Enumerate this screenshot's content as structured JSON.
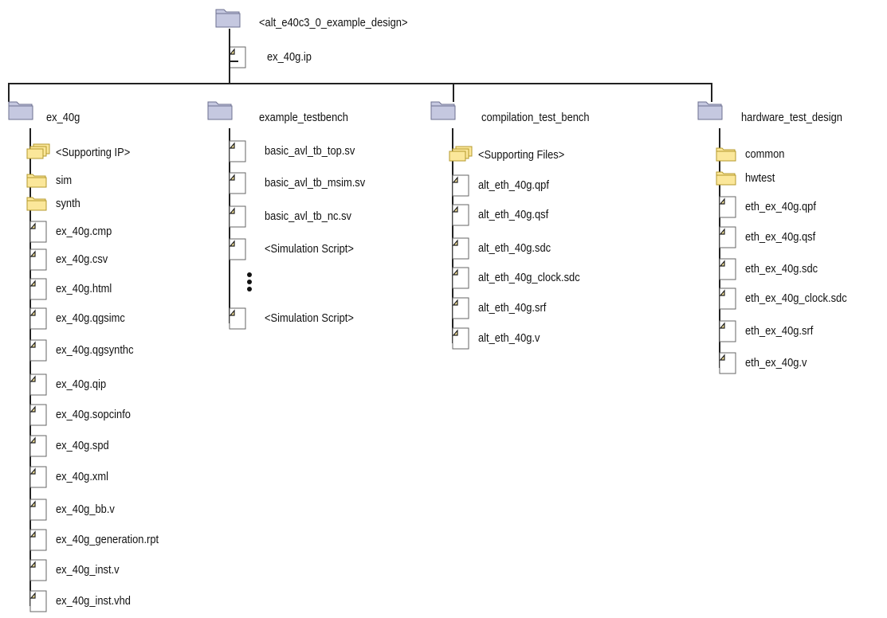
{
  "diagram": {
    "root": {
      "label": "<alt_e40c3_0_example_design>",
      "icon": "folder-icon",
      "children": [
        {
          "label": "ex_40g.ip",
          "icon": "file-icon"
        }
      ]
    },
    "columns": [
      {
        "label": "ex_40g",
        "icon": "folder-icon",
        "children": [
          {
            "label": "<Supporting IP>",
            "icon": "folder-stack-icon"
          },
          {
            "label": "sim",
            "icon": "folder-yellow-icon"
          },
          {
            "label": "synth",
            "icon": "folder-yellow-icon"
          },
          {
            "label": "ex_40g.cmp",
            "icon": "file-icon"
          },
          {
            "label": "ex_40g.csv",
            "icon": "file-icon"
          },
          {
            "label": "ex_40g.html",
            "icon": "file-icon"
          },
          {
            "label": "ex_40g.qgsimc",
            "icon": "file-icon"
          },
          {
            "label": "ex_40g.qgsynthc",
            "icon": "file-icon"
          },
          {
            "label": "ex_40g.qip",
            "icon": "file-icon"
          },
          {
            "label": "ex_40g.sopcinfo",
            "icon": "file-icon"
          },
          {
            "label": "ex_40g.spd",
            "icon": "file-icon"
          },
          {
            "label": "ex_40g.xml",
            "icon": "file-icon"
          },
          {
            "label": "ex_40g_bb.v",
            "icon": "file-icon"
          },
          {
            "label": "ex_40g_generation.rpt",
            "icon": "file-icon"
          },
          {
            "label": "ex_40g_inst.v",
            "icon": "file-icon"
          },
          {
            "label": "ex_40g_inst.vhd",
            "icon": "file-icon"
          }
        ]
      },
      {
        "label": "example_testbench",
        "icon": "folder-icon",
        "children": [
          {
            "label": "basic_avl_tb_top.sv",
            "icon": "file-icon"
          },
          {
            "label": "basic_avl_tb_msim.sv",
            "icon": "file-icon"
          },
          {
            "label": "basic_avl_tb_nc.sv",
            "icon": "file-icon"
          },
          {
            "label": "<Simulation Script>",
            "icon": "file-icon"
          },
          {
            "label": "",
            "icon": "ellipsis-icon"
          },
          {
            "label": "<Simulation Script>",
            "icon": "file-icon"
          }
        ]
      },
      {
        "label": "compilation_test_bench",
        "icon": "folder-icon",
        "children": [
          {
            "label": "<Supporting Files>",
            "icon": "folder-stack-icon"
          },
          {
            "label": "alt_eth_40g.qpf",
            "icon": "file-icon"
          },
          {
            "label": "alt_eth_40g.qsf",
            "icon": "file-icon"
          },
          {
            "label": "alt_eth_40g.sdc",
            "icon": "file-icon"
          },
          {
            "label": "alt_eth_40g_clock.sdc",
            "icon": "file-icon"
          },
          {
            "label": "alt_eth_40g.srf",
            "icon": "file-icon"
          },
          {
            "label": "alt_eth_40g.v",
            "icon": "file-icon"
          }
        ]
      },
      {
        "label": "hardware_test_design",
        "icon": "folder-icon",
        "children": [
          {
            "label": "common",
            "icon": "folder-yellow-icon"
          },
          {
            "label": "hwtest",
            "icon": "folder-yellow-icon"
          },
          {
            "label": "eth_ex_40g.qpf",
            "icon": "file-icon"
          },
          {
            "label": "eth_ex_40g.qsf",
            "icon": "file-icon"
          },
          {
            "label": "eth_ex_40g.sdc",
            "icon": "file-icon"
          },
          {
            "label": "eth_ex_40g_clock.sdc",
            "icon": "file-icon"
          },
          {
            "label": "eth_ex_40g.srf",
            "icon": "file-icon"
          },
          {
            "label": "eth_ex_40g.v",
            "icon": "file-icon"
          }
        ]
      }
    ],
    "colors": {
      "folder_top": "#c5c8e0",
      "folder_border": "#6d7090",
      "folder_yellow": "#fbe79a",
      "folder_yellow_border": "#b49a2c",
      "line": "#222222",
      "text": "#111111"
    }
  }
}
